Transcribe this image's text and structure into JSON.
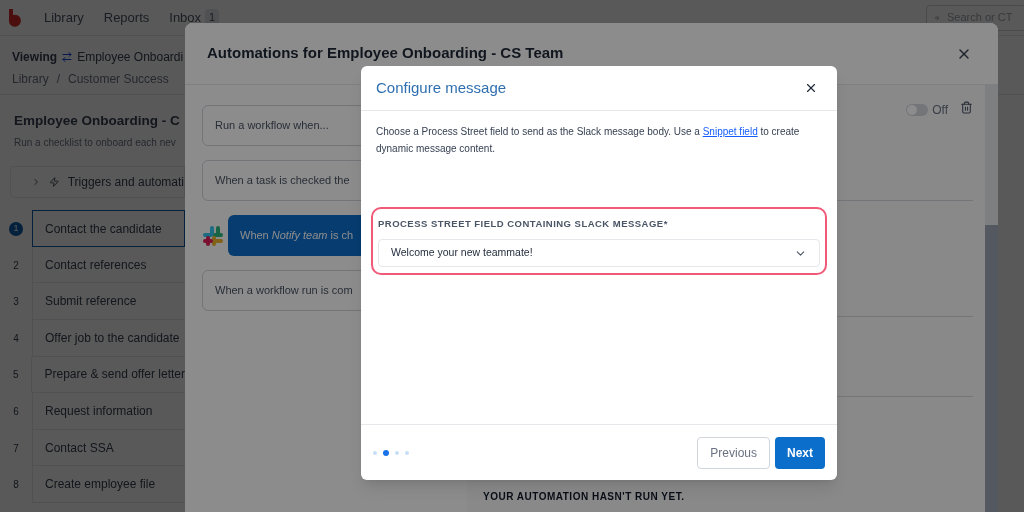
{
  "nav": {
    "items": [
      {
        "label": "Library"
      },
      {
        "label": "Reports"
      },
      {
        "label": "Inbox",
        "count": "1"
      }
    ],
    "search_placeholder": "Search or CT"
  },
  "header": {
    "viewing_label": "Viewing",
    "template_name": "Employee Onboardi",
    "breadcrumbs": [
      "Library",
      "Customer Success"
    ],
    "separator": "/"
  },
  "workflow": {
    "title": "Employee Onboarding - C",
    "description": "Run a checklist to onboard each nev",
    "triggers_label": "Triggers and automati",
    "tasks": [
      {
        "number": "1",
        "name": "Contact the candidate",
        "selected": true
      },
      {
        "number": "2",
        "name": "Contact references",
        "selected": false
      },
      {
        "number": "3",
        "name": "Submit reference",
        "selected": false
      },
      {
        "number": "4",
        "name": "Offer job to the candidate",
        "selected": false
      },
      {
        "number": "5",
        "name": "Prepare & send offer letter",
        "selected": false
      },
      {
        "number": "6",
        "name": "Request information",
        "selected": false
      },
      {
        "number": "7",
        "name": "Contact SSA",
        "selected": false
      },
      {
        "number": "8",
        "name": "Create employee file",
        "selected": false
      }
    ]
  },
  "automations_modal": {
    "title": "Automations for Employee Onboarding - CS Team",
    "triggers": [
      {
        "kind": "plain",
        "label": "Run a workflow when...",
        "selected": false
      },
      {
        "kind": "plain",
        "label": "When a task is checked the",
        "selected": false
      },
      {
        "kind": "slack",
        "label": "When *Notify team* is ch",
        "selected": true
      },
      {
        "kind": "plain",
        "label": "When a workflow run is com",
        "selected": false
      }
    ],
    "toggle": {
      "on": false,
      "label": "Off"
    },
    "status": "YOUR AUTOMATION HASN'T RUN YET."
  },
  "dialog": {
    "title": "Configure message",
    "description_before": "Choose a Process Street field to send as the Slack message body. Use a",
    "link": "Snippet field",
    "description_after": "to create dynamic message content.",
    "field_label": "PROCESS STREET FIELD CONTAINING SLACK MESSAGE*",
    "field_value": "Welcome your new teammate!",
    "highlighted": true,
    "steps": [
      {
        "selected": false
      },
      {
        "selected": true
      },
      {
        "selected": false
      },
      {
        "selected": false
      }
    ],
    "buttons": [
      {
        "kind": "secondary",
        "label": "Previous"
      },
      {
        "kind": "primary",
        "label": "Next"
      }
    ]
  }
}
